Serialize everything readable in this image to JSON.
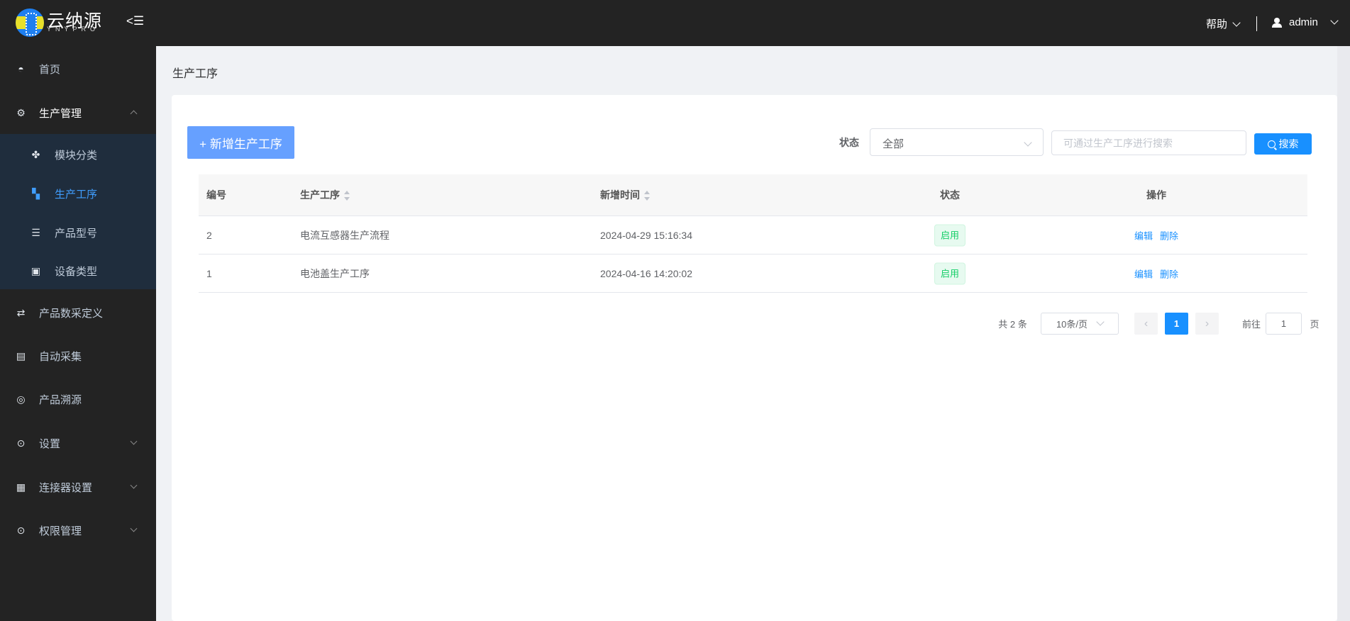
{
  "header": {
    "logo_text": "云纳源",
    "logo_sub": "YNYPRO",
    "help": "帮助",
    "user": "admin"
  },
  "sidebar": {
    "items": [
      {
        "label": "首页",
        "icon": "dashboard-icon"
      },
      {
        "label": "生产管理",
        "icon": "production-icon",
        "expanded": true,
        "children": [
          {
            "label": "模块分类",
            "icon": "grid-icon"
          },
          {
            "label": "生产工序",
            "icon": "process-icon",
            "active": true
          },
          {
            "label": "产品型号",
            "icon": "list-icon"
          },
          {
            "label": "设备类型",
            "icon": "monitor-icon"
          }
        ]
      },
      {
        "label": "产品数采定义",
        "icon": "flow-icon"
      },
      {
        "label": "自动采集",
        "icon": "collect-icon"
      },
      {
        "label": "产品溯源",
        "icon": "trace-icon"
      },
      {
        "label": "设置",
        "icon": "settings-icon"
      },
      {
        "label": "连接器设置",
        "icon": "connector-icon"
      },
      {
        "label": "权限管理",
        "icon": "permission-icon"
      }
    ]
  },
  "page": {
    "title": "生产工序",
    "add_button": "+ 新增生产工序"
  },
  "filter": {
    "status_label": "状态",
    "status_value": "全部",
    "search_placeholder": "可通过生产工序进行搜索",
    "search_button": "搜索"
  },
  "table": {
    "columns": [
      "编号",
      "生产工序",
      "新增时间",
      "状态",
      "操作"
    ],
    "rows": [
      {
        "id": "2",
        "name": "电流互感器生产流程",
        "time": "2024-04-29 15:16:34",
        "status": "启用",
        "edit": "编辑",
        "delete": "删除"
      },
      {
        "id": "1",
        "name": "电池盖生产工序",
        "time": "2024-04-16 14:20:02",
        "status": "启用",
        "edit": "编辑",
        "delete": "删除"
      }
    ]
  },
  "pagination": {
    "total": "共 2 条",
    "page_size": "10条/页",
    "current": "1",
    "goto_label": "前往",
    "goto_value": "1",
    "page_suffix": "页"
  },
  "colors": {
    "header": "#232323",
    "accent": "#1890ff",
    "submenu": "#1f2d3d",
    "tag_green": "#13ce66"
  }
}
